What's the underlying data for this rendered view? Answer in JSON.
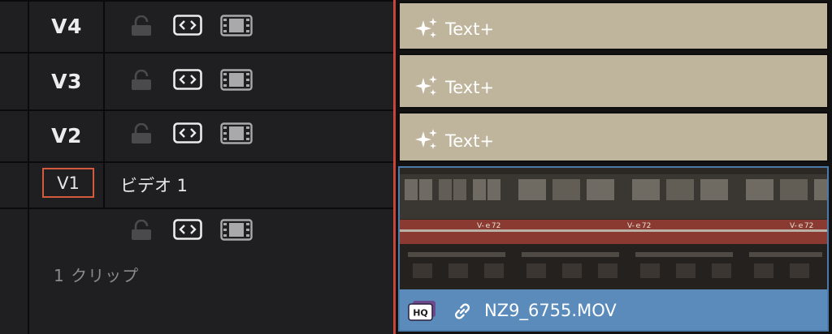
{
  "tracks": [
    {
      "id": "V4",
      "clip_label": "Text+"
    },
    {
      "id": "V3",
      "clip_label": "Text+"
    },
    {
      "id": "V2",
      "clip_label": "Text+"
    }
  ],
  "v1": {
    "id": "V1",
    "name": "ビデオ 1",
    "clip_count": "1 クリップ",
    "clip": {
      "badge": "HQ",
      "filename": "NZ9_6755.MOV"
    }
  },
  "icons": {
    "lock": "lock-icon",
    "auto_select": "auto-select-icon",
    "track_output": "film-strip-icon",
    "sparkle": "sparkle-icon",
    "link": "link-icon",
    "hq": "hq-badge-icon"
  },
  "colors": {
    "text_clip": "#bfb59d",
    "video_clip": "#5b8bbb",
    "playhead": "#c9453a",
    "selected_track_border": "#d35a3c"
  }
}
